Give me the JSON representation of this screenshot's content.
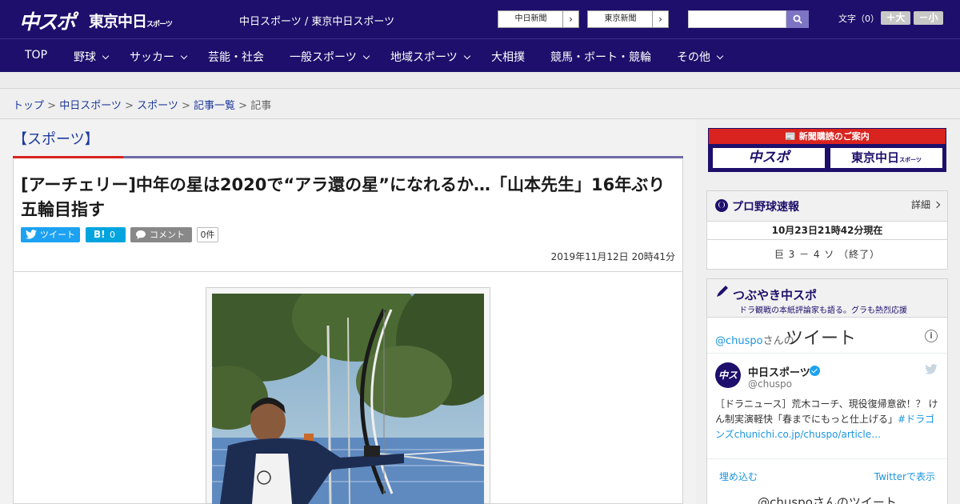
{
  "header": {
    "logo_chuspo": "中スポ",
    "logo_tokyo": "東京中日",
    "logo_tokyo_sub": "スポーツ",
    "site_names": "中日スポーツ / 東京中日スポーツ",
    "link_chunichi": "中日新聞",
    "link_tokyo": "東京新聞",
    "fontsize_label": "文字（0）",
    "fontsize_up": "＋大",
    "fontsize_down": "－小",
    "search": {
      "value": "",
      "placeholder": ""
    },
    "colors": {
      "bar": "#1d0f6b",
      "search_button": "#7e74c4"
    }
  },
  "nav": [
    {
      "label": "TOP",
      "dropdown": false
    },
    {
      "label": "野球",
      "dropdown": true
    },
    {
      "label": "サッカー",
      "dropdown": true
    },
    {
      "label": "芸能・社会",
      "dropdown": false
    },
    {
      "label": "一般スポーツ",
      "dropdown": true
    },
    {
      "label": "地域スポーツ",
      "dropdown": true
    },
    {
      "label": "大相撲",
      "dropdown": false
    },
    {
      "label": "競馬・ボート・競輪",
      "dropdown": false
    },
    {
      "label": "その他",
      "dropdown": true
    }
  ],
  "breadcrumb": {
    "items": [
      "トップ",
      "中日スポーツ",
      "スポーツ",
      "記事一覧"
    ],
    "current": "記事",
    "sep": " > "
  },
  "article": {
    "category": "【スポーツ】",
    "headline": "[アーチェリー]中年の星は2020で“アラ還の星”になれるか…「山本先生」16年ぶり五輪目指す",
    "tweet_label": "ツイート",
    "hatena_b": "B!",
    "hatena_count": "0",
    "comment_label": "コメント",
    "comment_count": "0件",
    "date": "2019年11月12日 20時41分",
    "colors": {
      "accent_red": "#d9231e",
      "accent_purple": "#6f6aa5"
    }
  },
  "sidebar": {
    "subscription": {
      "title": "新聞購読のご案内",
      "button_a": "中スポ",
      "button_b": "東京中日",
      "button_b_sub": "スポーツ"
    },
    "baseball": {
      "title": "プロ野球速報",
      "detail": "詳細",
      "time": "10月23日21時42分現在",
      "score": "巨 3 － 4 ソ （終了）"
    },
    "tsubuyaki": {
      "title": "つぶやき中スポ",
      "subtitle": "ドラ観戦の本紙評論家も語る。グラも熱烈応援",
      "handle_prefix": "@chuspo",
      "handle_suffix": "さんの",
      "tweets_word": "ツイート",
      "tweet": {
        "avatar_text": "中スポ",
        "name": "中日スポーツ",
        "handle": "@chuspo",
        "text_plain": "［ドラニュース］荒木コーチ、現役復帰意欲！？ けん制実演軽快「春までにもっと仕上げる」",
        "text_link": "#ドラゴンズchunichi.co.jp/chuspo/article…"
      },
      "embed": "埋め込む",
      "view_on_twitter": "Twitterで表示",
      "more": "@chuspoさんのツイート"
    }
  }
}
